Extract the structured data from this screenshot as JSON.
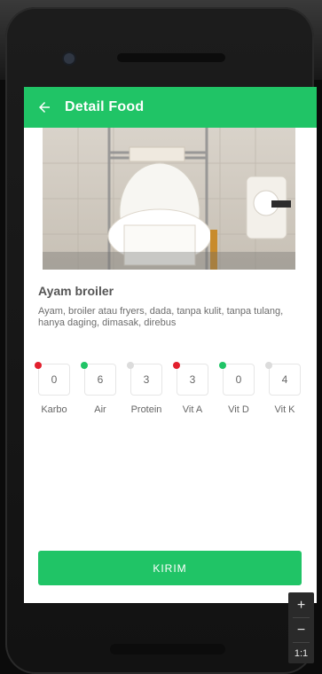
{
  "app": {
    "title": "Detail Food"
  },
  "food": {
    "name": "Ayam broiler",
    "description": "Ayam, broiler atau fryers, dada, tanpa kulit, tanpa tulang, hanya daging, dimasak, direbus"
  },
  "nutrients": [
    {
      "label": "Karbo",
      "value": "0",
      "status": "red"
    },
    {
      "label": "Air",
      "value": "6",
      "status": "green"
    },
    {
      "label": "Protein",
      "value": "3",
      "status": "grey"
    },
    {
      "label": "Vit A",
      "value": "3",
      "status": "red"
    },
    {
      "label": "Vit D",
      "value": "0",
      "status": "green"
    },
    {
      "label": "Vit K",
      "value": "4",
      "status": "grey"
    }
  ],
  "actions": {
    "submit_label": "KIRIM"
  },
  "zoom": {
    "plus": "+",
    "minus": "−",
    "ratio": "1:1"
  },
  "colors": {
    "accent": "#20c466",
    "status_red": "#e21f2d",
    "status_green": "#20c466",
    "status_grey": "#dcdcdc"
  },
  "icons": {
    "back": "arrow-left-icon",
    "zoom_in": "plus-icon",
    "zoom_out": "minus-icon"
  }
}
